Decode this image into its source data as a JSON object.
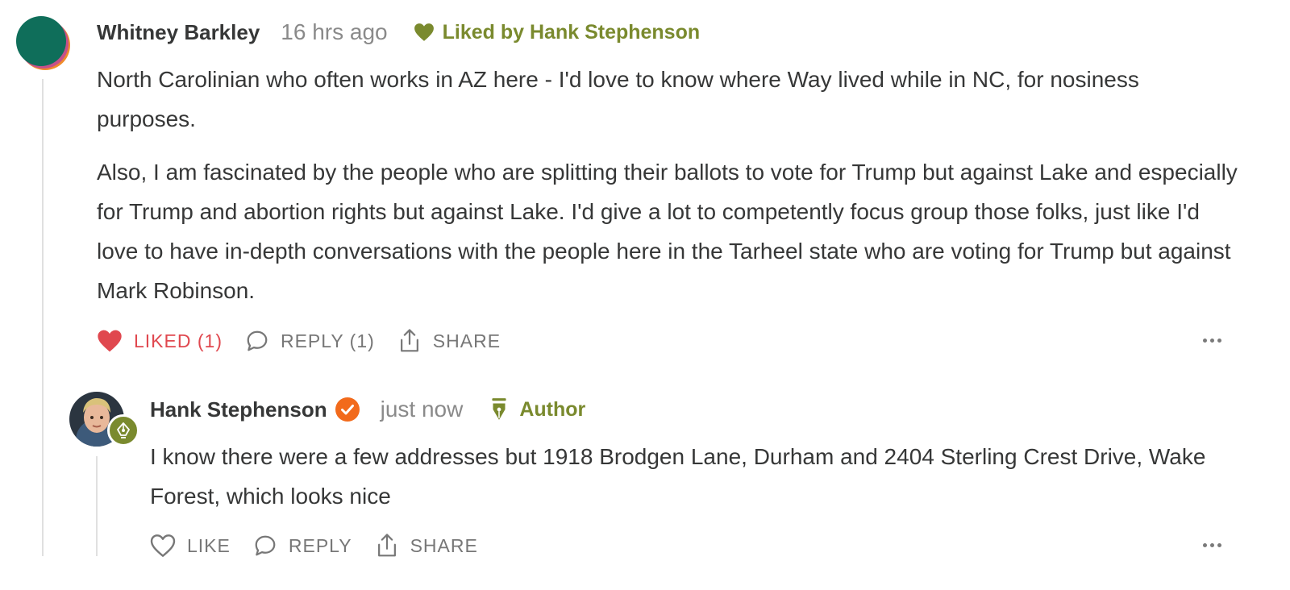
{
  "comment": {
    "author": "Whitney Barkley",
    "time": "16 hrs ago",
    "liked_by": "Liked by Hank Stephenson",
    "paragraphs": [
      "North Carolinian who often works in AZ here - I'd love to know where Way lived while in NC, for nosiness purposes.",
      "Also, I am fascinated by the people who are splitting their ballots to vote for Trump but against Lake and especially for Trump and abortion rights but against Lake. I'd give a lot to competently focus group those folks, just like I'd love to have in-depth conversations with the people here in the Tarheel state who are voting for Trump but against Mark Robinson."
    ],
    "actions": {
      "like": "LIKED (1)",
      "reply": "REPLY (1)",
      "share": "SHARE"
    },
    "colors": {
      "liked": "#e0484f",
      "avatar_primary": "#0f6e5a",
      "avatar_secondary": "#f08c2a"
    }
  },
  "reply": {
    "author": "Hank Stephenson",
    "time": "just now",
    "badge": "Author",
    "text": "I know there were a few addresses but 1918 Brodgen Lane, Durham and 2404 Sterling Crest Drive, Wake Forest, which looks nice",
    "actions": {
      "like": "LIKE",
      "reply": "REPLY",
      "share": "SHARE"
    },
    "colors": {
      "author_accent": "#7a8a2e",
      "verified": "#f26a1b"
    }
  }
}
